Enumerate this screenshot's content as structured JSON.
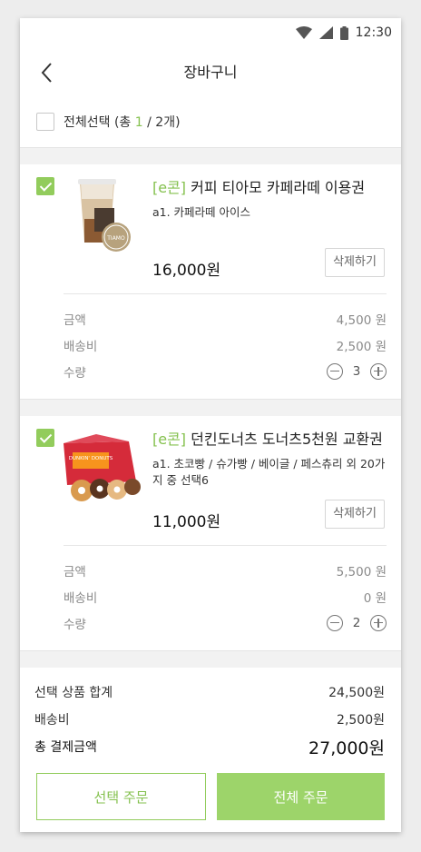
{
  "status": {
    "time": "12:30"
  },
  "header": {
    "title": "장바구니"
  },
  "select_all": {
    "label_prefix": "전체선택 (총 ",
    "selected": "1",
    "label_suffix": " / 2개)"
  },
  "items": [
    {
      "tag": "[e콘]",
      "name": "커피 티아모 카페라떼 이용권",
      "option": "a1. 카페라떼 아이스",
      "price": "16,000원",
      "delete_label": "삭제하기",
      "amount_label": "금액",
      "amount": "4,500 원",
      "shipping_label": "배송비",
      "shipping": "2,500 원",
      "qty_label": "수량",
      "qty": "3",
      "thumb_text": "TIAMO"
    },
    {
      "tag": "[e콘]",
      "name": "던킨도너츠 도너츠5천원 교환권",
      "option": "a1. 초코빵 / 슈가빵 / 베이글 / 페스츄리 외 20가지 중 선택6",
      "price": "11,000원",
      "delete_label": "삭제하기",
      "amount_label": "금액",
      "amount": "5,500 원",
      "shipping_label": "배송비",
      "shipping": "0 원",
      "qty_label": "수량",
      "qty": "2",
      "thumb_text": "DUNKIN' DONUTS"
    }
  ],
  "summary": {
    "subtotal_label": "선택 상품 합계",
    "subtotal": "24,500원",
    "shipping_label": "배송비",
    "shipping": "2,500원",
    "total_label": "총 결제금액",
    "total": "27,000원"
  },
  "buttons": {
    "order_selected": "선택 주문",
    "order_all": "전체 주문"
  },
  "colors": {
    "accent": "#92cc5c",
    "accent_text": "#85c14f"
  }
}
